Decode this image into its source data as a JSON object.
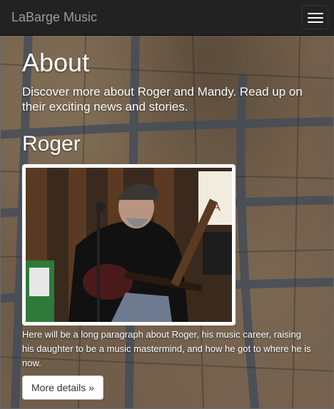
{
  "navbar": {
    "brand": "LaBarge Music",
    "toggle_icon": "hamburger-menu-icon"
  },
  "page": {
    "title": "About",
    "lead": "Discover more about Roger and Mandy. Read up on their exciting news and stories."
  },
  "section": {
    "title": "Roger",
    "bio": "Here will be a long paragraph about Roger, his music career, raising his daughter to be a music mastermind, and how he got to where he is now.",
    "button_label": "More details »"
  },
  "colors": {
    "navbar_bg": "#222222",
    "brand_text": "#9d9d9d",
    "text": "#ffffff",
    "button_bg": "#ffffff"
  }
}
